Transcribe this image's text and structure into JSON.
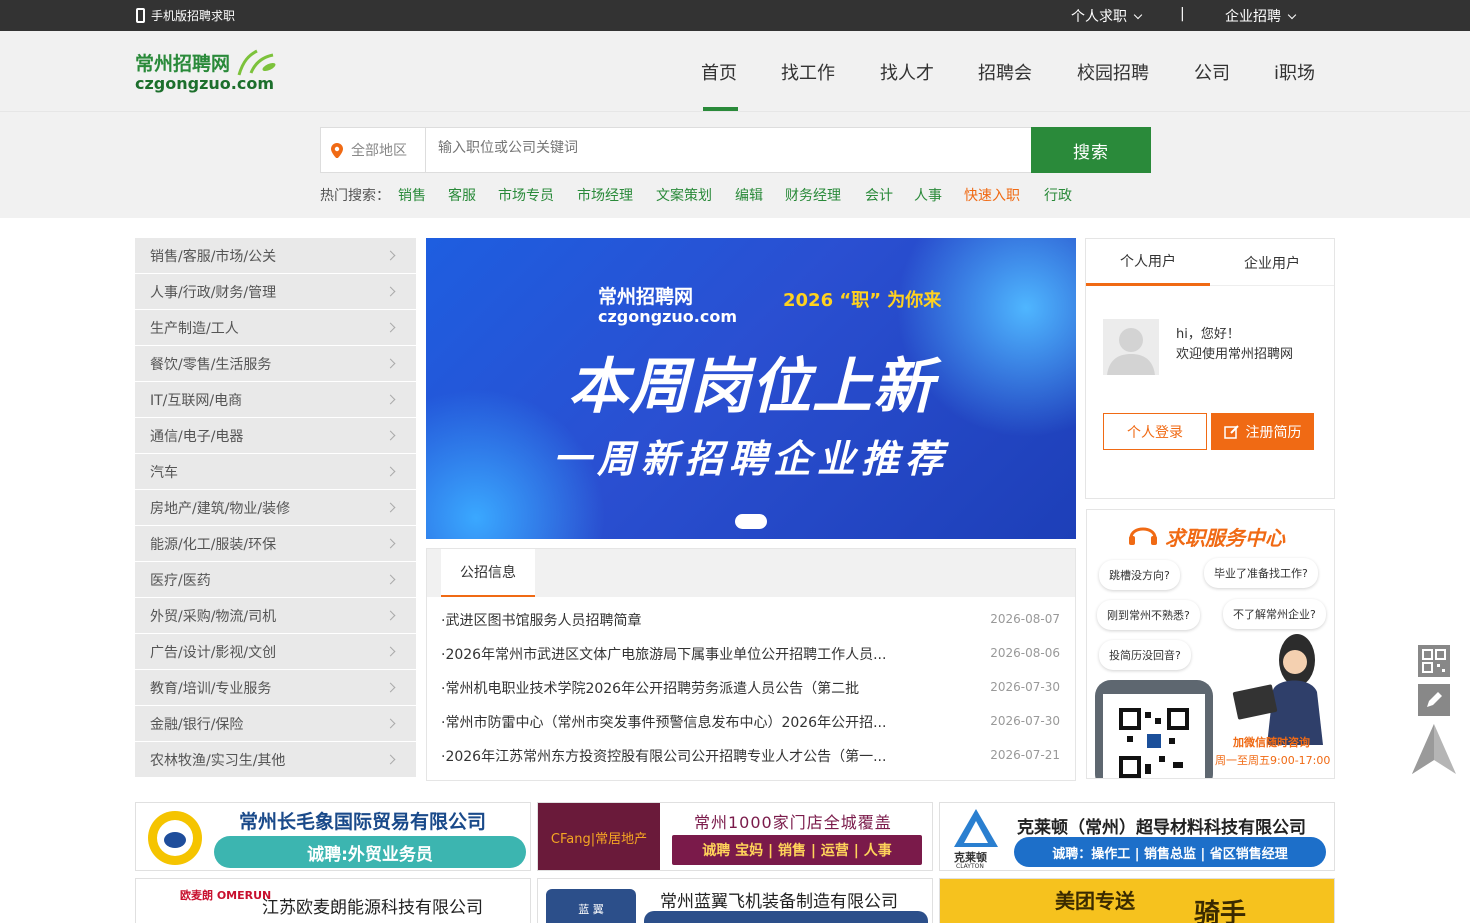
{
  "topbar": {
    "mobile": "手机版招聘求职",
    "personal": "个人求职",
    "divider": "|",
    "company": "企业招聘"
  },
  "logo": {
    "cn": "常州招聘网",
    "en": "czgongzuo.com"
  },
  "nav": [
    "首页",
    "找工作",
    "找人才",
    "招聘会",
    "校园招聘",
    "公司",
    "i职场"
  ],
  "search": {
    "region": "全部地区",
    "placeholder": "输入职位或公司关键词",
    "button": "搜索"
  },
  "hot": {
    "label": "热门搜索：",
    "keywords": [
      "销售",
      "客服",
      "市场专员",
      "市场经理",
      "文案策划",
      "编辑",
      "财务经理",
      "会计",
      "人事",
      "快速入职",
      "行政"
    ]
  },
  "categories": [
    "销售/客服/市场/公关",
    "人事/行政/财务/管理",
    "生产制造/工人",
    "餐饮/零售/生活服务",
    "IT/互联网/电商",
    "通信/电子/电器",
    "汽车",
    "房地产/建筑/物业/装修",
    "能源/化工/服装/环保",
    "医疗/医药",
    "外贸/采购/物流/司机",
    "广告/设计/影视/文创",
    "教育/培训/专业服务",
    "金融/银行/保险",
    "农林牧渔/实习生/其他"
  ],
  "banner": {
    "logo_cn": "常州招聘网",
    "logo_en": "czgongzuo.com",
    "slogan": "2026 “职” 为你来",
    "title": "本周岗位上新",
    "subtitle": "一周新招聘企业推荐"
  },
  "news": {
    "title": "公招信息",
    "items": [
      {
        "text": "·武进区图书馆服务人员招聘简章",
        "date": "2026-08-07"
      },
      {
        "text": "·2026年常州市武进区文体广电旅游局下属事业单位公开招聘工作人员...",
        "date": "2026-08-06"
      },
      {
        "text": "·常州机电职业技术学院2026年公开招聘劳务派遣人员公告（第二批",
        "date": "2026-07-30"
      },
      {
        "text": "·常州市防雷中心（常州市突发事件预警信息发布中心）2026年公开招...",
        "date": "2026-07-30"
      },
      {
        "text": "·2026年江苏常州东方投资控股有限公司公开招聘专业人才公告（第一...",
        "date": "2026-07-21"
      }
    ]
  },
  "user": {
    "tab_personal": "个人用户",
    "tab_company": "企业用户",
    "hi": "hi，您好！",
    "welcome": "欢迎使用常州招聘网",
    "login": "个人登录",
    "register": "注册简历"
  },
  "service": {
    "title": "求职服务中心",
    "bubbles": [
      "跳槽没方向?",
      "毕业了准备找工作?",
      "刚到常州不熟悉?",
      "不了解常州企业?",
      "投简历没回音?"
    ],
    "wechat": "加微信随时咨询",
    "hours": "周一至周五9:00-17:00"
  },
  "ads": [
    {
      "name": "常州长毛象国际贸易有限公司",
      "pill": "诚聘:外贸业务员"
    },
    {
      "brand": "CFang|常居地产",
      "name": "常州1000家门店全城覆盖",
      "pill": "诚聘  宝妈 | 销售 | 运营 | 人事"
    },
    {
      "name": "克莱顿（常州）超导材料科技有限公司",
      "pill": "诚聘：操作工 | 销售总监 | 省区销售经理",
      "brand": "克莱顿",
      "brand_en": "CLAYTON"
    },
    {
      "name": "江苏欧麦朗能源科技有限公司",
      "brand": "欧麦朗 OMERUN"
    },
    {
      "name": "常州蓝翼飞机装备制造有限公司",
      "brand": "蓝 翼"
    },
    {
      "name": "美团专送",
      "extra": "骑手"
    }
  ],
  "colors": {
    "green": "#2a8a3a",
    "orange": "#f06a14",
    "dark": "#333333"
  }
}
